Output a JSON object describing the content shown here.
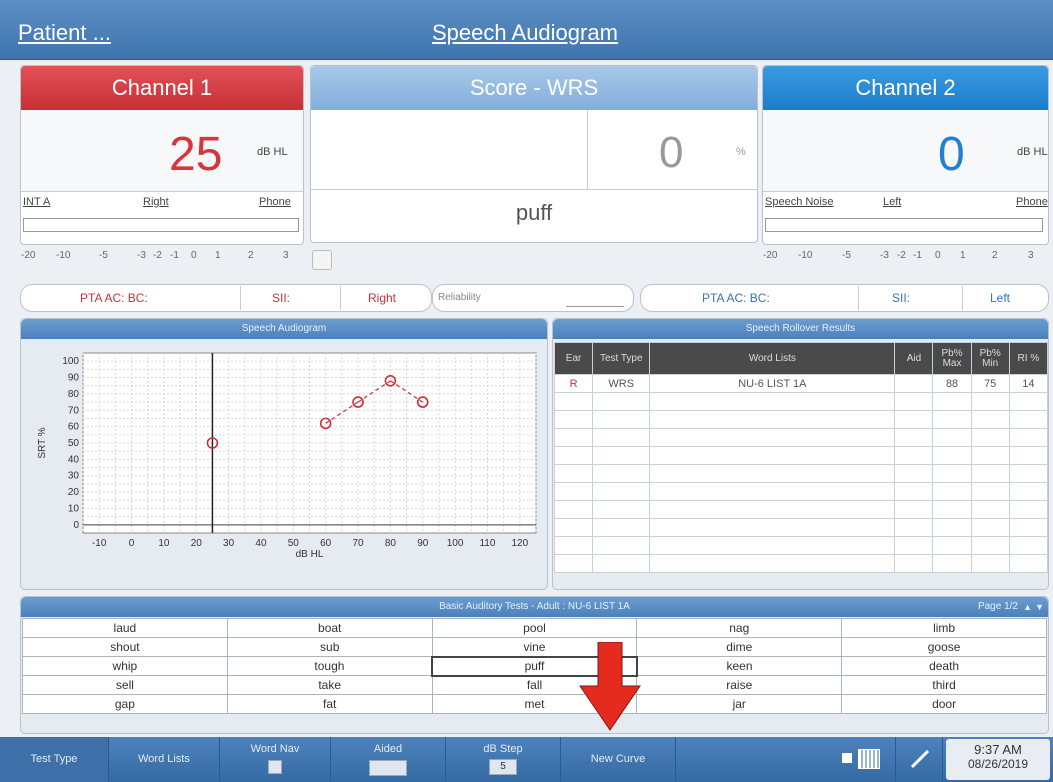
{
  "topbar": {
    "patient": "Patient ...",
    "title": "Speech Audiogram"
  },
  "channel1": {
    "title": "Channel 1",
    "value": "25",
    "unit": "dB HL",
    "transducer": "INT A",
    "ear": "Right",
    "output": "Phone",
    "scale": [
      "-20",
      "-10",
      "-5",
      "-3",
      "-2",
      "-1",
      "0",
      "1",
      "2",
      "3"
    ],
    "color": "#d8343c"
  },
  "score": {
    "title": "Score - WRS",
    "value": "0",
    "unit": "%",
    "word": "puff"
  },
  "channel2": {
    "title": "Channel 2",
    "value": "0",
    "unit": "dB HL",
    "transducer": "Speech Noise",
    "ear": "Left",
    "output": "Phone",
    "scale": [
      "-20",
      "-10",
      "-5",
      "-3",
      "-2",
      "-1",
      "0",
      "1",
      "2",
      "3"
    ],
    "color": "#1f7fd0"
  },
  "pta_right": {
    "pta": "PTA AC:  BC:",
    "sii": "SII:",
    "ear": "Right"
  },
  "reliability": {
    "label": "Reliability"
  },
  "pta_left": {
    "pta": "PTA AC:  BC:",
    "sii": "SII:",
    "ear": "Left"
  },
  "audiogram": {
    "header": "Speech Audiogram",
    "chart_data": {
      "type": "scatter",
      "xlabel": "dB HL",
      "ylabel": "SRT %",
      "xlim": [
        -15,
        125
      ],
      "ylim": [
        -5,
        105
      ],
      "xticks": [
        "-10",
        "0",
        "10",
        "20",
        "30",
        "40",
        "50",
        "60",
        "70",
        "80",
        "90",
        "100",
        "110",
        "120"
      ],
      "yticks": [
        "0",
        "10",
        "20",
        "30",
        "40",
        "50",
        "60",
        "70",
        "80",
        "90",
        "100"
      ],
      "vline_x": 25,
      "series": [
        {
          "points": [
            [
              25,
              50
            ]
          ],
          "color": "#c8323a",
          "connected": false
        },
        {
          "points": [
            [
              60,
              62
            ],
            [
              70,
              75
            ],
            [
              80,
              88
            ],
            [
              90,
              75
            ]
          ],
          "color": "#c8323a",
          "connected": true
        }
      ]
    }
  },
  "rollover": {
    "header": "Speech Rollover Results",
    "columns": [
      "Ear",
      "Test Type",
      "Word Lists",
      "Aid",
      "Pb% Max",
      "Pb% Min",
      "RI %"
    ],
    "rows": [
      [
        "R",
        "WRS",
        "NU-6 LIST 1A",
        "",
        "88",
        "75",
        "14"
      ]
    ],
    "empty_rows": 10
  },
  "words": {
    "header": "Basic Auditory Tests - Adult : NU-6 LIST 1A",
    "page": "Page 1/2",
    "grid": [
      [
        "laud",
        "boat",
        "pool",
        "nag",
        "limb"
      ],
      [
        "shout",
        "sub",
        "vine",
        "dime",
        "goose"
      ],
      [
        "whip",
        "tough",
        "puff",
        "keen",
        "death"
      ],
      [
        "sell",
        "take",
        "fall",
        "raise",
        "third"
      ],
      [
        "gap",
        "fat",
        "met",
        "jar",
        "door"
      ]
    ]
  },
  "bottombar": {
    "test_type": "Test Type",
    "word_lists": "Word Lists",
    "word_nav": "Word Nav",
    "aided": "Aided",
    "db_step": "dB Step",
    "db_step_value": "5",
    "new_curve": "New Curve",
    "time": "9:37 AM",
    "date": "08/26/2019"
  }
}
